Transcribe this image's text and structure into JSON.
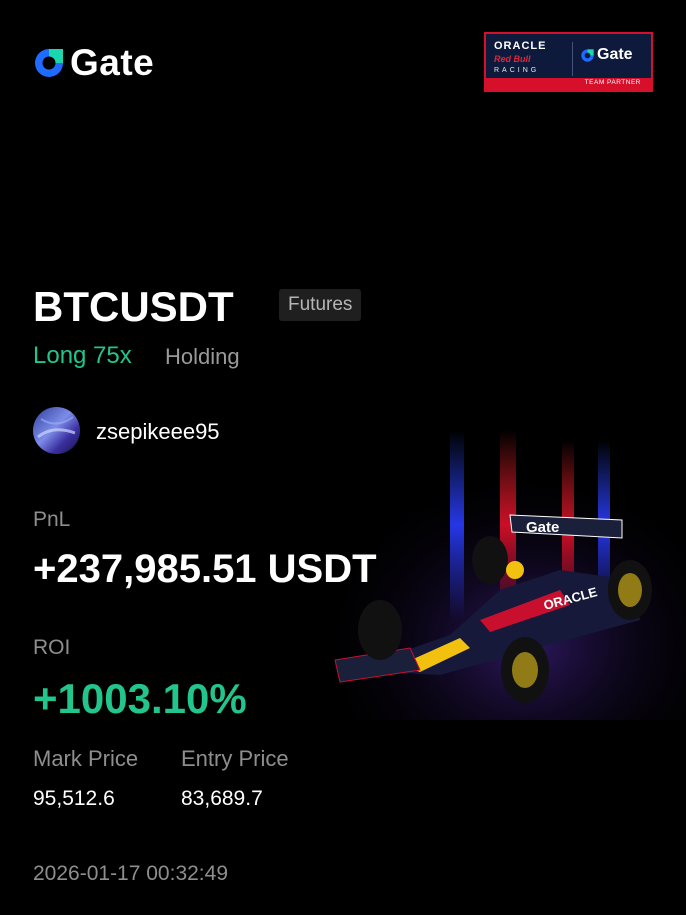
{
  "brand": {
    "name": "Gate",
    "icon": "gate-logo-icon",
    "color": "#1f6bff"
  },
  "partner": {
    "oracle": "ORACLE",
    "redbull": "Red Bull",
    "racing": "RACING",
    "gate": "Gate",
    "label": "TEAM PARTNER"
  },
  "position": {
    "symbol": "BTCUSDT",
    "type_tag": "Futures",
    "side": "Long 75x",
    "status": "Holding"
  },
  "user": {
    "username": "zsepikeee95",
    "avatar_icon": "user-avatar"
  },
  "stats": {
    "pnl_label": "PnL",
    "pnl_value": "+237,985.51 USDT",
    "roi_label": "ROI",
    "roi_value": "+1003.10%",
    "mark_price_label": "Mark Price",
    "mark_price_value": "95,512.6",
    "entry_price_label": "Entry Price",
    "entry_price_value": "83,689.7"
  },
  "timestamp": "2026-01-17 00:32:49",
  "colors": {
    "profit": "#22c58b",
    "muted": "#8e8e8e",
    "background": "#000000",
    "accent_red": "#d6102b"
  }
}
